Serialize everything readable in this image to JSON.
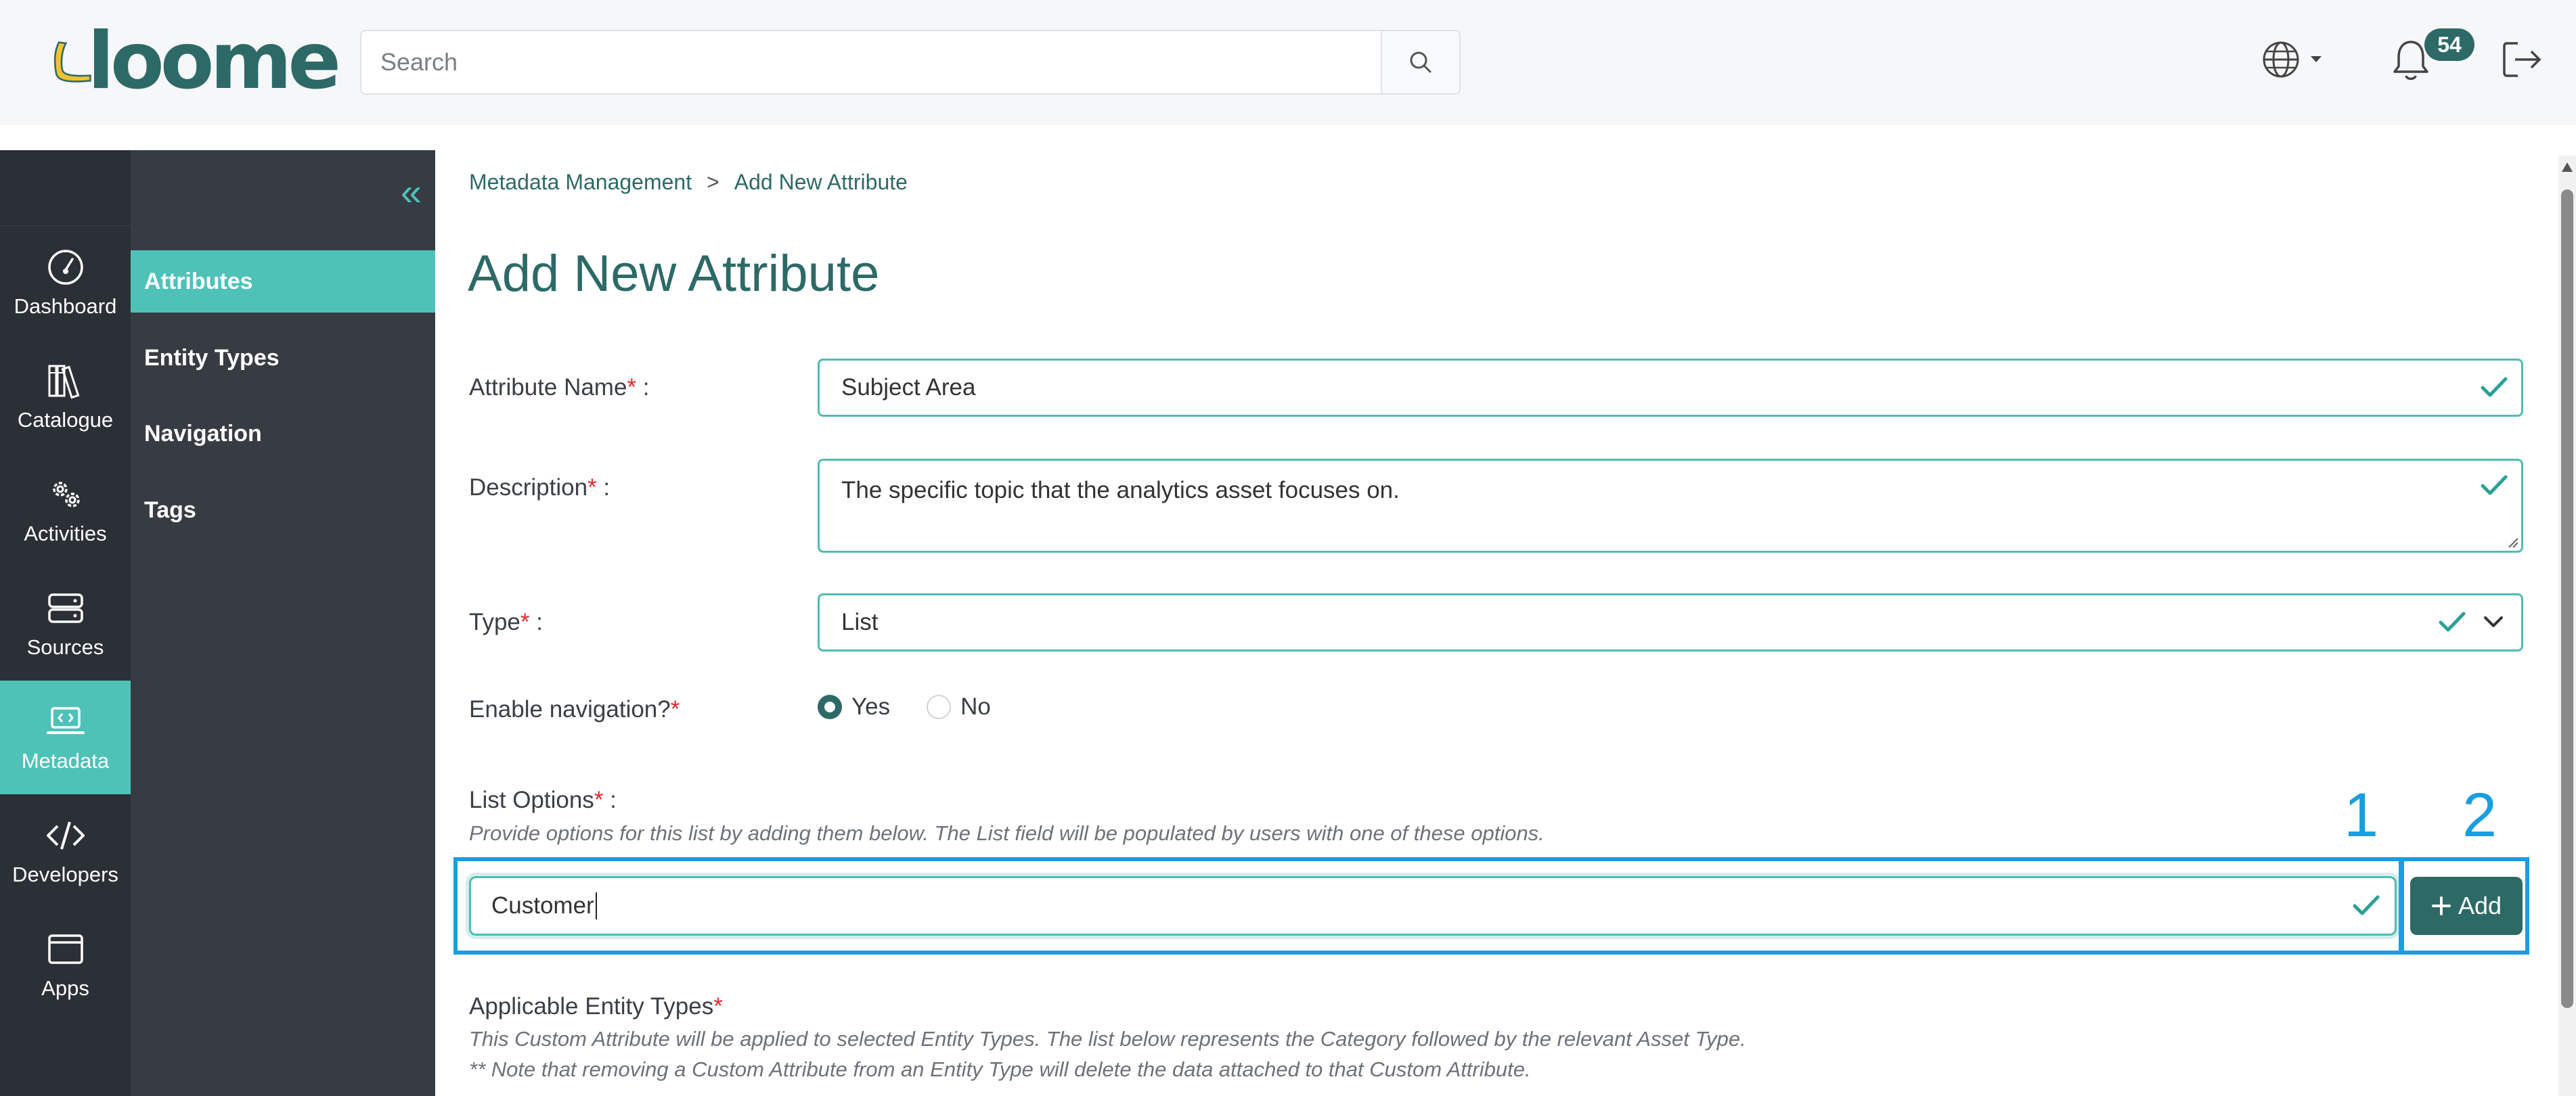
{
  "app": {
    "logo_text": "loome",
    "search_placeholder": "Search",
    "notifications_count": "54",
    "colors": {
      "brand": "#2d6a67",
      "accent": "#4fc2b8",
      "required": "#e02b2b",
      "callout": "#1a9ee0"
    }
  },
  "rail": {
    "items": [
      {
        "label": "Dashboard",
        "icon": "dashboard-icon"
      },
      {
        "label": "Catalogue",
        "icon": "catalogue-icon"
      },
      {
        "label": "Activities",
        "icon": "activities-icon"
      },
      {
        "label": "Sources",
        "icon": "sources-icon"
      },
      {
        "label": "Metadata",
        "icon": "metadata-icon"
      },
      {
        "label": "Developers",
        "icon": "developers-icon"
      },
      {
        "label": "Apps",
        "icon": "apps-icon"
      }
    ]
  },
  "submenu": {
    "collapse_icon": "«",
    "items": [
      {
        "label": "Attributes"
      },
      {
        "label": "Entity Types"
      },
      {
        "label": "Navigation"
      },
      {
        "label": "Tags"
      }
    ]
  },
  "breadcrumb": {
    "parent": "Metadata Management",
    "separator": ">",
    "current": "Add New Attribute"
  },
  "page": {
    "title": "Add New Attribute",
    "required_mark": "*",
    "attribute_name": {
      "label": "Attribute Name",
      "suffix": " :",
      "value": "Subject Area"
    },
    "description": {
      "label": "Description",
      "suffix": " :",
      "value": "The specific topic that the analytics asset focuses on."
    },
    "type": {
      "label": "Type",
      "suffix": " :",
      "value": "List"
    },
    "enable_navigation": {
      "label": "Enable navigation?",
      "options": [
        "Yes",
        "No"
      ],
      "selected": "Yes"
    },
    "list_options": {
      "label": "List Options",
      "suffix": " :",
      "help": "Provide options for this list by adding them below. The List field will be populated by users with one of these options.",
      "value": "Customer",
      "add_label": "Add"
    },
    "applicable_entity_types": {
      "label": "Applicable Entity Types",
      "help1": "This Custom Attribute will be applied to selected Entity Types. The list below represents the Category followed by the relevant Asset Type.",
      "help2": "** Note that removing a Custom Attribute from an Entity Type will delete the data attached to that Custom Attribute."
    }
  },
  "callouts": {
    "one": "1",
    "two": "2"
  }
}
